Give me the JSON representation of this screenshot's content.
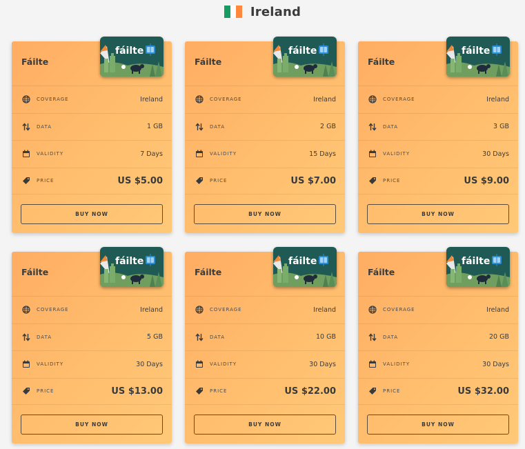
{
  "header": {
    "title": "Ireland",
    "flag_colors": [
      "#169b62",
      "#ffffff",
      "#ff883e"
    ]
  },
  "labels": {
    "coverage": "COVERAGE",
    "data": "DATA",
    "validity": "VALIDITY",
    "price": "PRICE",
    "buy": "BUY NOW"
  },
  "esim_brand": "fáilte",
  "cards": [
    {
      "name": "Fáilte",
      "coverage": "Ireland",
      "data": "1 GB",
      "validity": "7 Days",
      "price": "US $5.00"
    },
    {
      "name": "Fáilte",
      "coverage": "Ireland",
      "data": "2 GB",
      "validity": "15 Days",
      "price": "US $7.00"
    },
    {
      "name": "Fáilte",
      "coverage": "Ireland",
      "data": "3 GB",
      "validity": "30 Days",
      "price": "US $9.00"
    },
    {
      "name": "Fáilte",
      "coverage": "Ireland",
      "data": "5 GB",
      "validity": "30 Days",
      "price": "US $13.00"
    },
    {
      "name": "Fáilte",
      "coverage": "Ireland",
      "data": "10 GB",
      "validity": "30 Days",
      "price": "US $22.00"
    },
    {
      "name": "Fáilte",
      "coverage": "Ireland",
      "data": "20 GB",
      "validity": "30 Days",
      "price": "US $32.00"
    }
  ],
  "icons": {
    "coverage": "globe-icon",
    "data": "arrows-up-down-icon",
    "validity": "calendar-icon",
    "price": "price-tag-icon"
  }
}
